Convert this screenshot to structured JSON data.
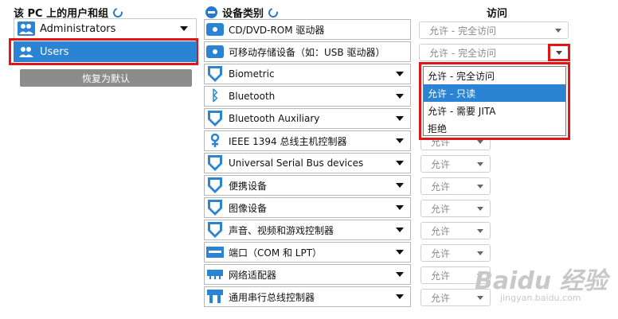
{
  "left_panel": {
    "header": "该 PC 上的用户和组",
    "users": [
      {
        "label": "Administrators",
        "has_dropdown": true
      },
      {
        "label": "Users",
        "selected": true
      }
    ],
    "restore_button": "恢复为默认"
  },
  "device_panel": {
    "header": "设备类别",
    "devices": [
      {
        "label": "CD/DVD-ROM 驱动器",
        "icon": "disk-icon",
        "has_dropdown": false
      },
      {
        "label": "可移动存储设备（如：USB 驱动器）",
        "icon": "disk-icon",
        "has_dropdown": false
      },
      {
        "label": "Biometric",
        "icon": "shield-icon",
        "has_dropdown": true
      },
      {
        "label": "Bluetooth",
        "icon": "bluetooth-icon",
        "has_dropdown": true
      },
      {
        "label": "Bluetooth Auxiliary",
        "icon": "shield-icon",
        "has_dropdown": true
      },
      {
        "label": "IEEE 1394 总线主机控制器",
        "icon": "firewire-icon",
        "has_dropdown": true
      },
      {
        "label": "Universal Serial Bus devices",
        "icon": "shield-icon",
        "has_dropdown": true
      },
      {
        "label": "便携设备",
        "icon": "shield-icon",
        "has_dropdown": true
      },
      {
        "label": "图像设备",
        "icon": "shield-icon",
        "has_dropdown": true
      },
      {
        "label": "声音、视频和游戏控制器",
        "icon": "shield-icon",
        "has_dropdown": true
      },
      {
        "label": "端口（COM 和 LPT）",
        "icon": "port-icon",
        "has_dropdown": true
      },
      {
        "label": "网络适配器",
        "icon": "network-icon",
        "has_dropdown": true
      },
      {
        "label": "通用串行总线控制器",
        "icon": "usb-controller-icon",
        "has_dropdown": true
      }
    ]
  },
  "access_panel": {
    "header": "访问",
    "values": [
      "允许 - 完全访问",
      "允许 - 完全访问",
      "允许",
      "允许",
      "允许",
      "允许",
      "允许",
      "允许",
      "允许",
      "允许",
      "允许",
      "允许",
      "允许"
    ],
    "open_dropdown": {
      "options": [
        "允许 - 完全访问",
        "允许 - 只读",
        "允许 - 需要 JITA",
        "拒绝"
      ],
      "highlighted": "允许 - 只读"
    }
  },
  "watermark": {
    "main": "Baidu 经验",
    "sub": "jingyan.baidu.com"
  },
  "colors": {
    "accent": "#2a84d3",
    "highlight_box": "#e01616"
  }
}
